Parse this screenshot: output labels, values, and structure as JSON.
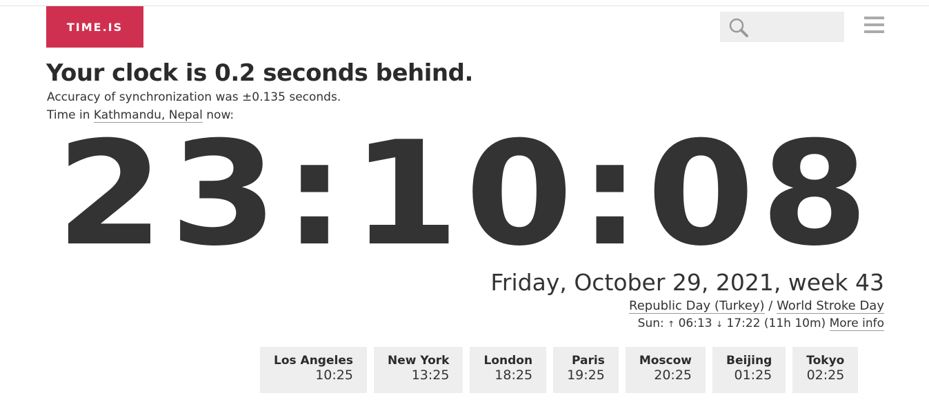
{
  "brand": {
    "logo_text": "TIME.IS",
    "accent_color": "#d03050"
  },
  "search": {
    "placeholder": "",
    "icon": "search-icon"
  },
  "menu": {
    "icon": "hamburger-menu-icon"
  },
  "headline": "Your clock is 0.2 seconds behind.",
  "accuracy_text": "Accuracy of synchronization was ±0.135 seconds.",
  "location": {
    "prefix": "Time in ",
    "place": "Kathmandu, Nepal",
    "suffix": " now:"
  },
  "clock": "23:10:08",
  "date": "Friday, October 29, 2021, week 43",
  "holidays": {
    "first": "Republic Day (Turkey)",
    "separator": " / ",
    "second": "World Stroke Day"
  },
  "sun": {
    "label": "Sun: ",
    "rise_arrow": "↑",
    "rise": " 06:13 ",
    "set_arrow": "↓",
    "set": " 17:22 (11h 10m) ",
    "more": "More info"
  },
  "cities": [
    {
      "name": "Los Angeles",
      "time": "10:25"
    },
    {
      "name": "New York",
      "time": "13:25"
    },
    {
      "name": "London",
      "time": "18:25"
    },
    {
      "name": "Paris",
      "time": "19:25"
    },
    {
      "name": "Moscow",
      "time": "20:25"
    },
    {
      "name": "Beijing",
      "time": "01:25"
    },
    {
      "name": "Tokyo",
      "time": "02:25"
    }
  ]
}
